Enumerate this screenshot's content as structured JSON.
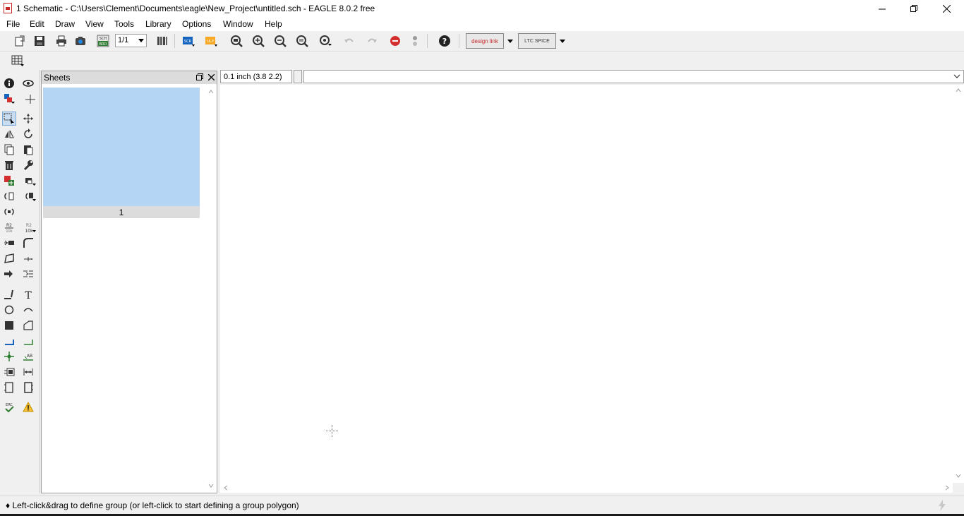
{
  "window": {
    "title": "1 Schematic - C:\\Users\\Clement\\Documents\\eagle\\New_Project\\untitled.sch - EAGLE 8.0.2 free"
  },
  "menu": {
    "file": "File",
    "edit": "Edit",
    "draw": "Draw",
    "view": "View",
    "tools": "Tools",
    "library": "Library",
    "options": "Options",
    "window": "Window",
    "help": "Help"
  },
  "toolbar": {
    "sheet_selector": "1/1",
    "scr_label": "SCR",
    "ulp_label": "ULP",
    "sch_brd_label_top": "SCH",
    "sch_brd_label_bottom": "BRD",
    "designlink_label": "design link",
    "ltspice_label": "LTC SPICE"
  },
  "sheets_panel": {
    "title": "Sheets",
    "sheets": [
      {
        "label": "1"
      }
    ]
  },
  "coord_bar": {
    "grid_coord": "0.1 inch (3.8 2.2)",
    "command_value": ""
  },
  "status": {
    "message": "♦ Left-click&drag to define group (or left-click to start defining a group polygon)"
  },
  "tools": {
    "label_r2_top": "R2",
    "label_10k": "10k",
    "label_ab": "AB",
    "label_erc": "ERC"
  },
  "colors": {
    "sheet_thumb": "#b5d5f5",
    "stop_red": "#d32f2f",
    "accent_blue": "#1565c0",
    "accent_green": "#2e7d32"
  }
}
